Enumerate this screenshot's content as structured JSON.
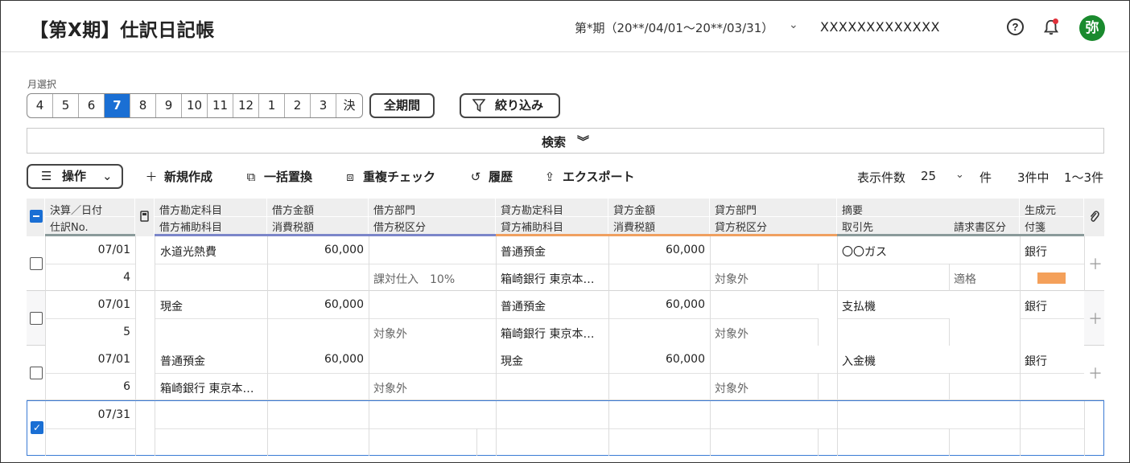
{
  "header": {
    "title": "【第X期】仕訳日記帳",
    "period": "第*期（20**/04/01〜20**/03/31）",
    "company": "XXXXXXXXXXXXX",
    "help_icon": "question-circle-icon",
    "bell_icon": "bell-icon",
    "avatar": "弥",
    "avatar_color": "#1a8a2e"
  },
  "month_select": {
    "label": "月選択",
    "months": [
      "4",
      "5",
      "6",
      "7",
      "8",
      "9",
      "10",
      "11",
      "12",
      "1",
      "2",
      "3",
      "決"
    ],
    "selected": "7",
    "all_label": "全期間",
    "filter_label": "絞り込み"
  },
  "search": {
    "label": "検索"
  },
  "toolbar": {
    "ops_label": "操作",
    "new_label": "新規作成",
    "replace_label": "一括置換",
    "dup_label": "重複チェック",
    "history_label": "履歴",
    "export_label": "エクスポート",
    "page_size_label": "表示件数",
    "page_size": "25",
    "page_unit": "件",
    "total": "3件中",
    "range": "1〜3件"
  },
  "columns": {
    "date_1": "決算／日付",
    "date_2": "仕訳No.",
    "debit_acct_1": "借方勘定科目",
    "debit_acct_2": "借方補助科目",
    "debit_amt_1": "借方金額",
    "debit_amt_2": "消費税額",
    "debit_dept_1": "借方部門",
    "debit_dept_2": "借方税区分",
    "credit_acct_1": "貸方勘定科目",
    "credit_acct_2": "貸方補助科目",
    "credit_amt_1": "貸方金額",
    "credit_amt_2": "消費税額",
    "credit_dept_1": "貸方部門",
    "credit_dept_2": "貸方税区分",
    "memo_1": "摘要",
    "memo_2": "取引先",
    "invoice": "請求書区分",
    "source_1": "生成元",
    "source_2": "付箋"
  },
  "accent_colors": {
    "debit": "#7b86c9",
    "credit": "#f0a060",
    "memo": "#8a9a9a",
    "selected": "#1a6fd4"
  },
  "rows": [
    {
      "date": "07/01",
      "no": "4",
      "debit_acct": "水道光熱費",
      "debit_sub": "",
      "debit_amt": "60,000",
      "debit_tax": "",
      "debit_dept": "",
      "debit_taxcls": "課対仕入　10%",
      "credit_acct": "普通預金",
      "credit_sub": "箱崎銀行 東京本…",
      "credit_amt": "60,000",
      "credit_tax": "",
      "credit_dept": "",
      "credit_taxcls": "対象外",
      "memo": "〇〇ガス",
      "partner": "",
      "invoice": "適格",
      "source": "銀行",
      "sticky": true
    },
    {
      "date": "07/01",
      "no": "5",
      "debit_acct": "現金",
      "debit_sub": "",
      "debit_amt": "60,000",
      "debit_tax": "",
      "debit_dept": "",
      "debit_taxcls": "対象外",
      "credit_acct": "普通預金",
      "credit_sub": "箱崎銀行 東京本…",
      "credit_amt": "60,000",
      "credit_tax": "",
      "credit_dept": "",
      "credit_taxcls": "対象外",
      "memo": "支払機",
      "partner": "",
      "invoice": "",
      "source": "銀行",
      "sticky": false
    },
    {
      "date": "07/01",
      "no": "6",
      "debit_acct": "普通預金",
      "debit_sub": "箱崎銀行 東京本…",
      "debit_amt": "60,000",
      "debit_tax": "",
      "debit_dept": "",
      "debit_taxcls": "対象外",
      "credit_acct": "現金",
      "credit_sub": "",
      "credit_amt": "60,000",
      "credit_tax": "",
      "credit_dept": "",
      "credit_taxcls": "対象外",
      "memo": "入金機",
      "partner": "",
      "invoice": "",
      "source": "銀行",
      "sticky": false
    }
  ],
  "new_row": {
    "date": "07/31"
  }
}
